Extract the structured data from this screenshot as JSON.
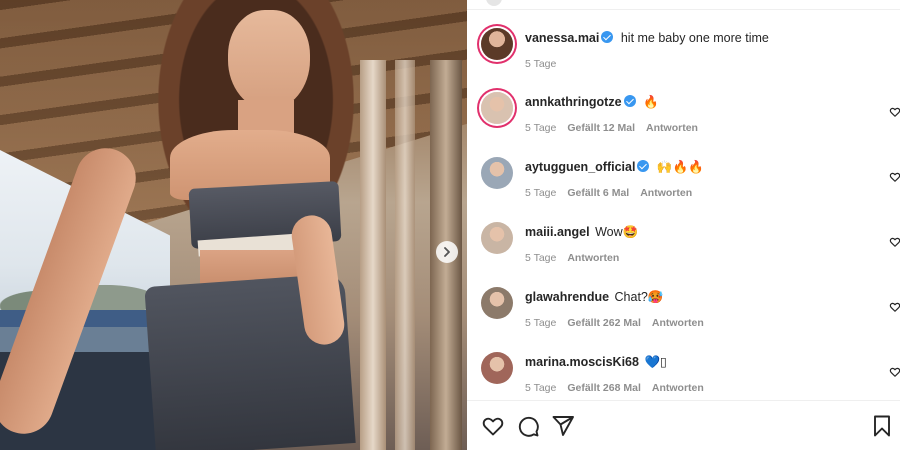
{
  "post": {
    "image_alt": "",
    "next_arrow": "chevron-right-icon"
  },
  "caption": {
    "username": "vanessa.mai",
    "verified": true,
    "text": "hit me baby one more time",
    "time": "5 Tage"
  },
  "comments": [
    {
      "username": "annkathringotze",
      "verified": true,
      "text": "🔥",
      "time": "5 Tage",
      "likes": "Gefällt 12 Mal",
      "reply": "Antworten",
      "avatar_color": "#d9c2b0",
      "story": true
    },
    {
      "username": "aytugguen_official",
      "verified": true,
      "text": "🙌🔥🔥",
      "time": "5 Tage",
      "likes": "Gefällt 6 Mal",
      "reply": "Antworten",
      "avatar_color": "#9aa7b6",
      "story": false
    },
    {
      "username": "maiii.angel",
      "verified": false,
      "text": "Wow🤩",
      "time": "5 Tage",
      "likes": "",
      "reply": "Antworten",
      "avatar_color": "#c9b5a4",
      "story": false
    },
    {
      "username": "glawahrendue",
      "verified": false,
      "text": "Chat?🥵",
      "time": "5 Tage",
      "likes": "Gefällt 262 Mal",
      "reply": "Antworten",
      "avatar_color": "#8c7a6a",
      "story": false
    },
    {
      "username": "marina.moscisKi68",
      "verified": false,
      "text": "💙▯",
      "time": "5 Tage",
      "likes": "Gefällt 268 Mal",
      "reply": "Antworten",
      "avatar_color": "#a0665a",
      "story": false
    }
  ],
  "actions": {
    "like": "heart-icon",
    "comment": "comment-icon",
    "share": "share-icon",
    "save": "bookmark-icon"
  },
  "colors": {
    "verified": "#3897f0",
    "text": "#262626",
    "meta": "#8e8e8e",
    "story_ring": "#e1306c"
  }
}
